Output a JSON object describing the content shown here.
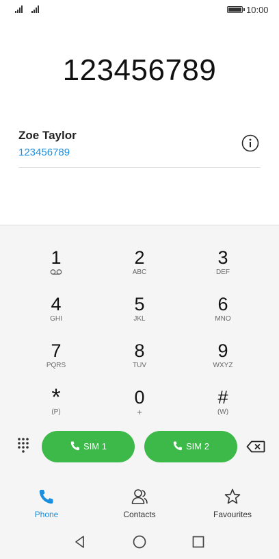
{
  "status_bar": {
    "time": "10:00"
  },
  "dialer": {
    "number": "123456789"
  },
  "contact": {
    "name": "Zoe Taylor",
    "number": "123456789"
  },
  "keypad": {
    "keys": [
      {
        "digit": "1",
        "sub": ""
      },
      {
        "digit": "2",
        "sub": "ABC"
      },
      {
        "digit": "3",
        "sub": "DEF"
      },
      {
        "digit": "4",
        "sub": "GHI"
      },
      {
        "digit": "5",
        "sub": "JKL"
      },
      {
        "digit": "6",
        "sub": "MNO"
      },
      {
        "digit": "7",
        "sub": "PQRS"
      },
      {
        "digit": "8",
        "sub": "TUV"
      },
      {
        "digit": "9",
        "sub": "WXYZ"
      },
      {
        "digit": "*",
        "sub": "(P)"
      },
      {
        "digit": "0",
        "sub": "+"
      },
      {
        "digit": "#",
        "sub": "(W)"
      }
    ]
  },
  "call_buttons": {
    "sim1": "SIM 1",
    "sim2": "SIM 2"
  },
  "bottom_nav": {
    "phone": "Phone",
    "contacts": "Contacts",
    "favourites": "Favourites"
  },
  "colors": {
    "accent": "#1a8fe0",
    "call_green": "#3db94a"
  }
}
